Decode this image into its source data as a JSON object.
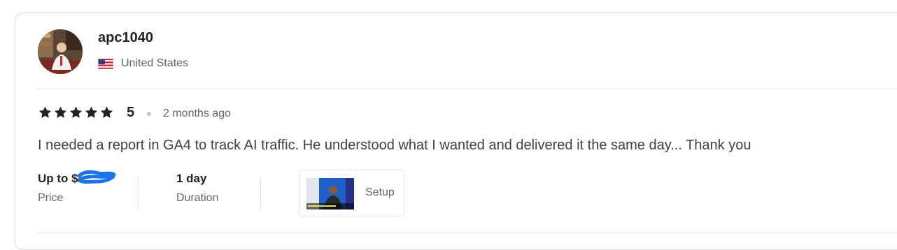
{
  "review": {
    "username": "apc1040",
    "country": "United States",
    "rating": "5",
    "stars": 5,
    "time_ago": "2 months ago",
    "text": "I needed a report in GA4 to track AI traffic. He understood what I wanted and delivered it the same day... Thank you",
    "price": {
      "value": "Up to $",
      "label": "Price"
    },
    "duration": {
      "value": "1 day",
      "label": "Duration"
    },
    "deliverable": {
      "label": "Setup"
    }
  },
  "colors": {
    "text_primary": "#222325",
    "text_secondary": "#62646a",
    "border": "#dadbdd",
    "redaction_scribble": "#1a73e8"
  },
  "icons": [
    "star-icon",
    "us-flag-icon"
  ]
}
